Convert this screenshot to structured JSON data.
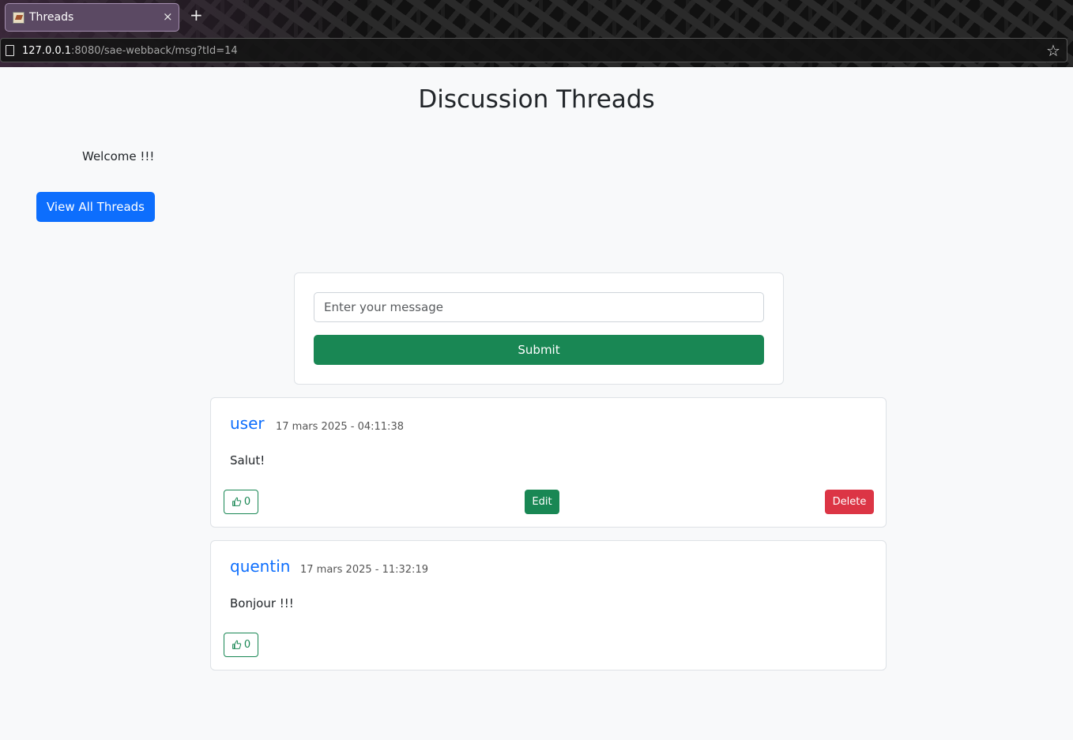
{
  "browser": {
    "tab_title": "Threads",
    "tab_close": "×",
    "new_tab": "+",
    "url_host": "127.0.0.1",
    "url_path": ":8080/sae-webback/msg?tId=14",
    "bookmark_icon": "star-icon"
  },
  "page": {
    "title": "Discussion Threads",
    "welcome": "Welcome !!!",
    "view_all_label": "View All Threads"
  },
  "form": {
    "placeholder": "Enter your message",
    "value": "",
    "submit_label": "Submit"
  },
  "messages": [
    {
      "author": "user",
      "timestamp": "17 mars 2025 - 04:11:38",
      "text": "Salut!",
      "likes": "0",
      "edit_label": "Edit",
      "delete_label": "Delete"
    },
    {
      "author": "quentin",
      "timestamp": "17 mars 2025 - 11:32:19",
      "text": "Bonjour !!!",
      "likes": "0"
    }
  ],
  "colors": {
    "primary": "#0d6efd",
    "success": "#198754",
    "danger": "#dc3545",
    "background": "#f8f9fa"
  }
}
